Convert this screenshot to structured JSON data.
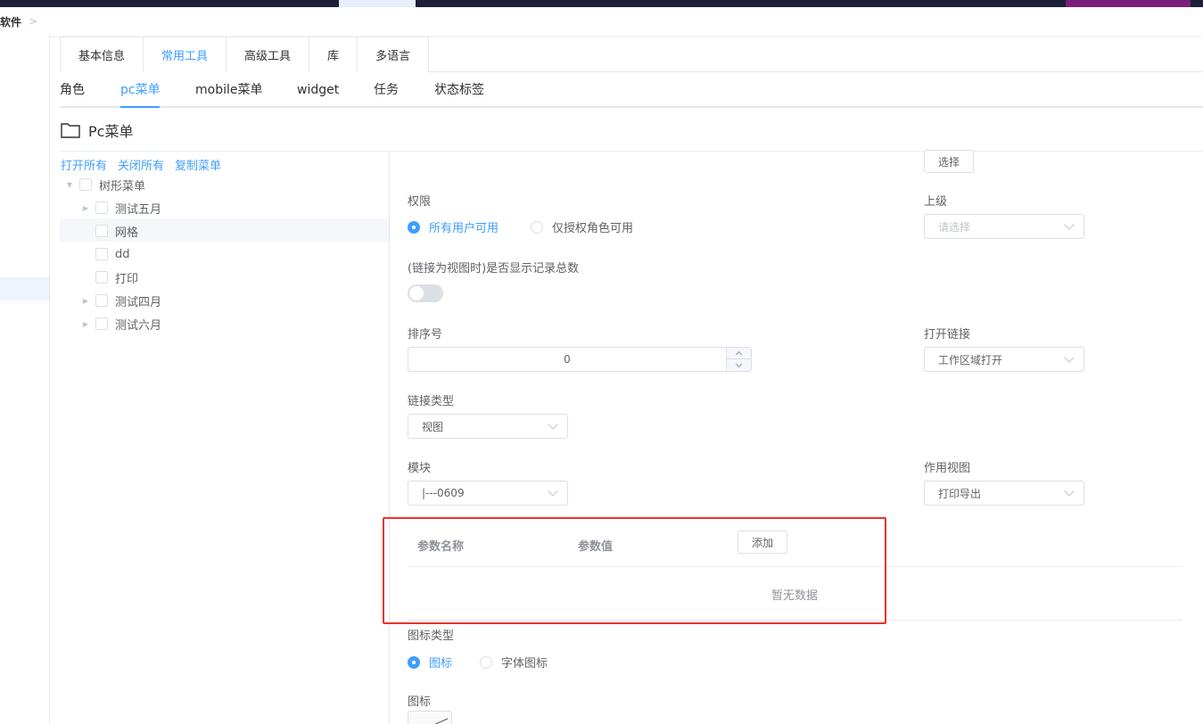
{
  "breadcrumb": {
    "current": "软件"
  },
  "tabs": [
    {
      "label": "基本信息"
    },
    {
      "label": "常用工具"
    },
    {
      "label": "高级工具"
    },
    {
      "label": "库"
    },
    {
      "label": "多语言"
    }
  ],
  "subtabs": [
    {
      "label": "角色"
    },
    {
      "label": "pc菜单"
    },
    {
      "label": "mobile菜单"
    },
    {
      "label": "widget"
    },
    {
      "label": "任务"
    },
    {
      "label": "状态标签"
    }
  ],
  "card": {
    "title": "Pc菜单"
  },
  "tree": {
    "actions": {
      "open_all": "打开所有",
      "close_all": "关闭所有",
      "copy_menu": "复制菜单"
    },
    "root": "树形菜单",
    "nodes": [
      {
        "label": "测试五月",
        "has_children": true
      },
      {
        "label": "网格",
        "has_children": false
      },
      {
        "label": "dd",
        "has_children": false
      },
      {
        "label": "打印",
        "has_children": false
      },
      {
        "label": "测试四月",
        "has_children": true
      },
      {
        "label": "测试六月",
        "has_children": true
      }
    ]
  },
  "form": {
    "select_button": "选择",
    "permission": {
      "label": "权限",
      "options": [
        "所有用户可用",
        "仅授权角色可用"
      ],
      "selected": "所有用户可用"
    },
    "parent": {
      "label": "上级",
      "placeholder": "请选择"
    },
    "show_total": {
      "label": "(链接为视图时)是否显示记录总数",
      "on": false
    },
    "sort_no": {
      "label": "排序号",
      "value": "0"
    },
    "open_link": {
      "label": "打开链接",
      "value": "工作区域打开"
    },
    "link_type": {
      "label": "链接类型",
      "value": "视图"
    },
    "module": {
      "label": "模块",
      "value": "|---0609"
    },
    "scope_view": {
      "label": "作用视图",
      "value": "打印导出"
    },
    "params": {
      "col_name": "参数名称",
      "col_value": "参数值",
      "add_button": "添加",
      "empty_text": "暂无数据"
    },
    "icon_type": {
      "label": "图标类型",
      "options": [
        "图标",
        "字体图标"
      ],
      "selected": "图标"
    },
    "icon": {
      "label": "图标"
    }
  },
  "colors": {
    "primary": "#409eff",
    "highlight_box": "#e8332b"
  }
}
